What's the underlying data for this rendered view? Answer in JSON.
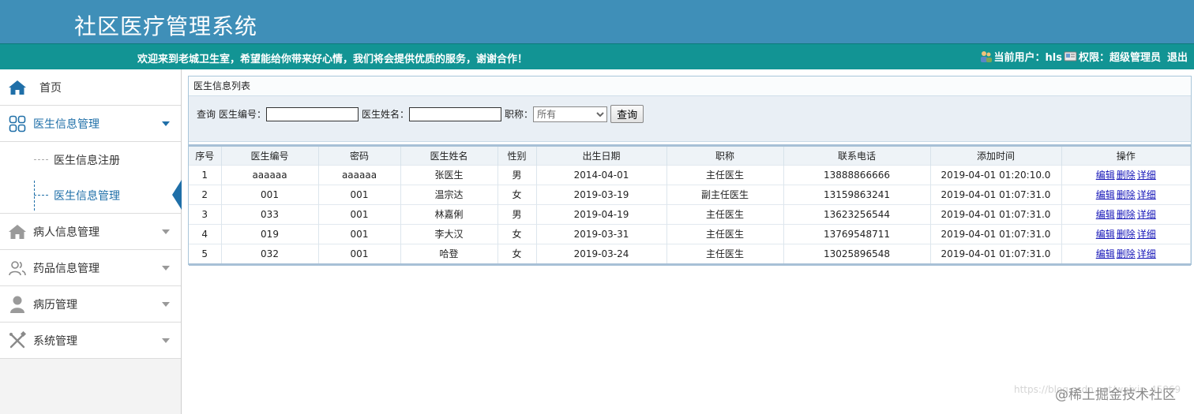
{
  "header": {
    "app_title": "社区医疗管理系统",
    "welcome": "欢迎来到老城卫生室，希望能给你带来好心情，我们将会提供优质的服务，谢谢合作！",
    "current_user_label": "当前用户：hls",
    "permission_label": "权限：超级管理员",
    "logout_label": "退出"
  },
  "sidebar": {
    "items": [
      {
        "label": "首页",
        "icon": "home-icon"
      },
      {
        "label": "医生信息管理",
        "icon": "grid-icon",
        "expanded": true,
        "children": [
          {
            "label": "医生信息注册"
          },
          {
            "label": "医生信息管理"
          }
        ]
      },
      {
        "label": "病人信息管理",
        "icon": "house-icon"
      },
      {
        "label": "药品信息管理",
        "icon": "users-icon"
      },
      {
        "label": "病历管理",
        "icon": "person-icon"
      },
      {
        "label": "系统管理",
        "icon": "tools-icon"
      }
    ]
  },
  "panel": {
    "title": "医生信息列表",
    "search": {
      "query_label": "查询",
      "doctor_id_label": "医生编号：",
      "doctor_id_value": "",
      "doctor_name_label": "医生姓名：",
      "doctor_name_value": "",
      "title_label": "职称：",
      "title_selected": "所有",
      "submit_label": "查询"
    },
    "columns": [
      "序号",
      "医生编号",
      "密码",
      "医生姓名",
      "性别",
      "出生日期",
      "职称",
      "联系电话",
      "添加时间",
      "操作"
    ],
    "rows": [
      [
        "1",
        "aaaaaa",
        "aaaaaa",
        "张医生",
        "男",
        "2014-04-01",
        "主任医生",
        "13888866666",
        "2019-04-01 01:20:10.0"
      ],
      [
        "2",
        "001",
        "001",
        "温宗达",
        "女",
        "2019-03-19",
        "副主任医生",
        "13159863241",
        "2019-04-01 01:07:31.0"
      ],
      [
        "3",
        "033",
        "001",
        "林嘉俐",
        "男",
        "2019-04-19",
        "主任医生",
        "13623256544",
        "2019-04-01 01:07:31.0"
      ],
      [
        "4",
        "019",
        "001",
        "李大汉",
        "女",
        "2019-03-31",
        "主任医生",
        "13769548711",
        "2019-04-01 01:07:31.0"
      ],
      [
        "5",
        "032",
        "001",
        "哈登",
        "女",
        "2019-03-24",
        "主任医生",
        "13025896548",
        "2019-04-01 01:07:31.0"
      ]
    ],
    "actions": [
      "编辑",
      "删除",
      "详细"
    ]
  },
  "watermark": {
    "url": "https://blog.csdn.net/weixin_45869",
    "logo": "@稀土掘金技术社区"
  },
  "colors": {
    "header_bg": "#3f8fb8",
    "welcome_bg": "#129494",
    "accent": "#1f6fa8",
    "link": "#1515b8"
  }
}
